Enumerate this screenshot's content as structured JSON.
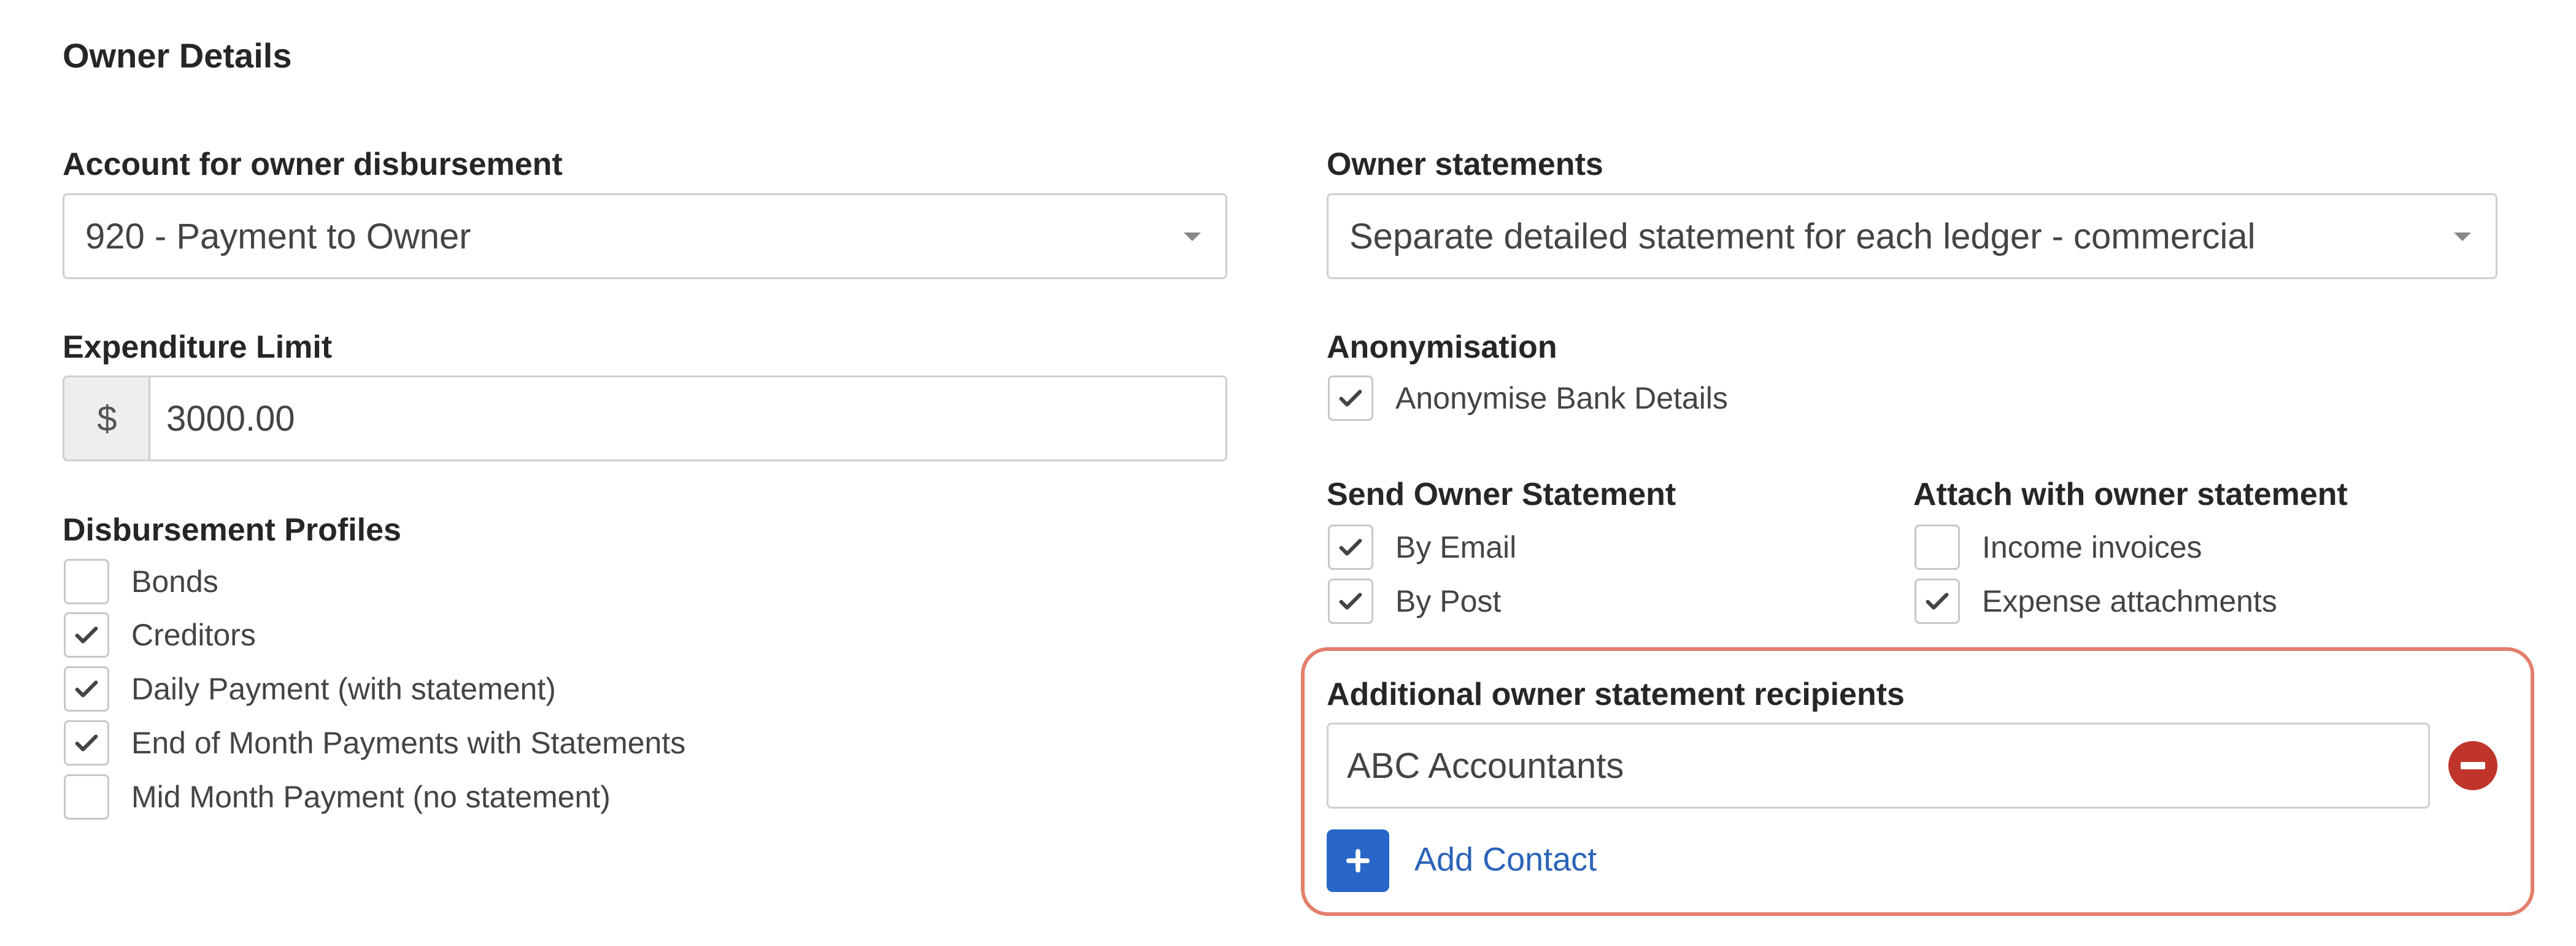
{
  "section_title": "Owner Details",
  "left": {
    "disbursement_account": {
      "label": "Account for owner disbursement",
      "value": "920 - Payment to Owner"
    },
    "expenditure_limit": {
      "label": "Expenditure Limit",
      "prefix": "$",
      "value": "3000.00"
    },
    "disbursement_profiles": {
      "label": "Disbursement Profiles",
      "items": [
        {
          "label": "Bonds",
          "checked": false
        },
        {
          "label": "Creditors",
          "checked": true
        },
        {
          "label": "Daily Payment (with statement)",
          "checked": true
        },
        {
          "label": "End of Month Payments with Statements",
          "checked": true
        },
        {
          "label": "Mid Month Payment (no statement)",
          "checked": false
        }
      ]
    }
  },
  "right": {
    "owner_statements": {
      "label": "Owner statements",
      "value": "Separate detailed statement for each ledger - commercial"
    },
    "anonymisation": {
      "label": "Anonymisation",
      "items": [
        {
          "label": "Anonymise Bank Details",
          "checked": true
        }
      ]
    },
    "send_owner_statement": {
      "label": "Send Owner Statement",
      "items": [
        {
          "label": "By Email",
          "checked": true
        },
        {
          "label": "By Post",
          "checked": true
        }
      ]
    },
    "attach_with_statement": {
      "label": "Attach with owner statement",
      "items": [
        {
          "label": "Income invoices",
          "checked": false
        },
        {
          "label": "Expense attachments",
          "checked": true
        }
      ]
    },
    "additional_recipients": {
      "label": "Additional owner statement recipients",
      "recipient_value": "ABC Accountants",
      "add_contact_label": "Add Contact"
    }
  },
  "colors": {
    "highlight_border": "#e27f6b",
    "remove_button": "#c0352b",
    "add_button": "#2866c9",
    "link": "#2b63b8"
  },
  "icons": {
    "check": "check-icon",
    "dropdown": "caret-down-icon",
    "remove": "minus-circle-icon",
    "add": "plus-icon"
  }
}
